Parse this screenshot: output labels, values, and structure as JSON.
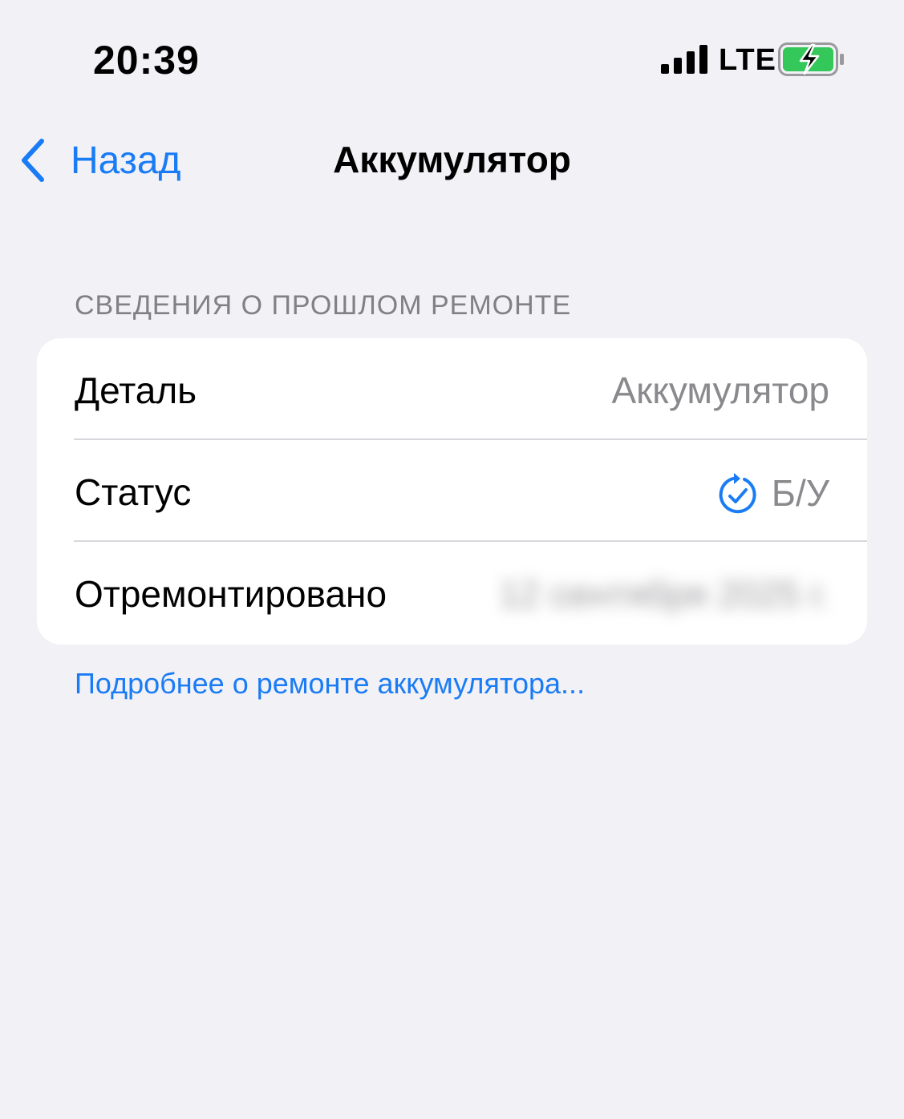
{
  "status_bar": {
    "time": "20:39",
    "network": "LTE",
    "signal_bars": 4,
    "battery_charging": true,
    "battery_color": "#34c759"
  },
  "nav": {
    "back_label": "Назад",
    "title": "Аккумулятор"
  },
  "section": {
    "header": "СВЕДЕНИЯ О ПРОШЛОМ РЕМОНТЕ",
    "rows": [
      {
        "label": "Деталь",
        "value": "Аккумулятор"
      },
      {
        "label": "Статус",
        "value": "Б/У",
        "icon": "used-part-check-icon"
      },
      {
        "label": "Отремонтировано",
        "value": "12 сентября 2025 г."
      }
    ],
    "footer_link": "Подробнее о ремонте аккумулятора..."
  },
  "colors": {
    "accent": "#1a7cf5",
    "background": "#f2f1f6",
    "secondary_text": "#8a8a8e"
  }
}
